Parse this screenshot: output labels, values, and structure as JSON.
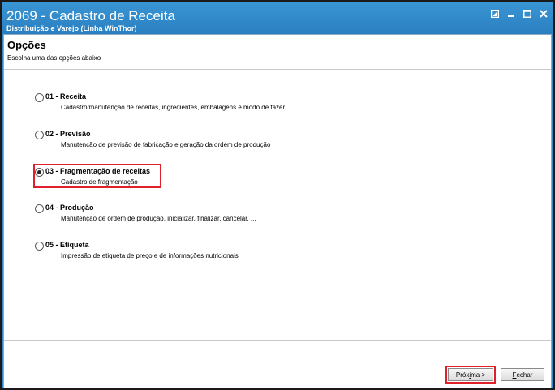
{
  "window": {
    "title": "2069 - Cadastro de Receita",
    "subtitle": "Distribuição e Varejo (Linha WinThor)",
    "controls": [
      {
        "icon": "restore-icon"
      },
      {
        "icon": "minimize-icon"
      },
      {
        "icon": "maximize-icon"
      },
      {
        "icon": "close-icon"
      }
    ]
  },
  "header": {
    "title": "Opções",
    "subtitle": "Escolha uma das opções abaixo"
  },
  "options": [
    {
      "label": "01 - Receita",
      "description": "Cadastro/manutenção de receitas, ingredientes, embalagens e modo de fazer",
      "checked": false
    },
    {
      "label": "02 - Previsão",
      "description": "Manutenção de previsão de fabricação e geração da ordem de produção",
      "checked": false
    },
    {
      "label": "03 - Fragmentação de receitas",
      "description": "Cadastro de fragmentação",
      "checked": true
    },
    {
      "label": "04 - Produção",
      "description": "Manutenção de ordem de produção, inicializar, finalizar, cancelar, ...",
      "checked": false
    },
    {
      "label": "05 - Etiqueta",
      "description": "Impressão de etiqueta de preço e de informações nutricionais",
      "checked": false
    }
  ],
  "footer": {
    "next_label_a": "Próx",
    "next_label_u": "i",
    "next_label_b": "ma >",
    "close_label_u": "F",
    "close_label_b": "echar"
  },
  "colors": {
    "titlebar": "#2f86c6",
    "highlight": "#e0202a"
  }
}
